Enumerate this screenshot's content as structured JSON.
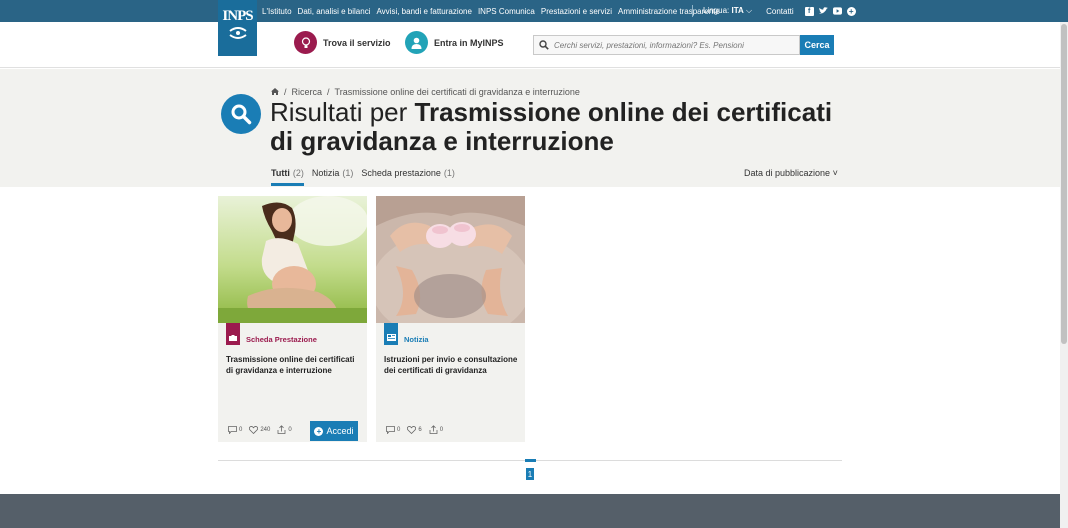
{
  "topbar": {
    "logo_text": "INPS",
    "links": [
      "L'Istituto",
      "Dati, analisi e bilanci",
      "Avvisi, bandi e fatturazione",
      "INPS Comunica",
      "Prestazioni e servizi",
      "Amministrazione trasparente"
    ],
    "lingua_label": "Lingua:",
    "lingua_value": "ITA",
    "contatti": "Contatti",
    "social_icons": [
      "facebook-icon",
      "twitter-icon",
      "youtube-icon",
      "plus-icon"
    ]
  },
  "header": {
    "trova": "Trova il servizio",
    "myinps": "Entra in MyINPS",
    "search_placeholder": "Cerchi servizi, prestazioni, informazioni? Es. Pensioni",
    "search_button": "Cerca",
    "colors": {
      "trova": "#9b1b4e",
      "myinps": "#22a3b7",
      "accent": "#1a7db5"
    }
  },
  "results": {
    "breadcrumb": [
      "Ricerca",
      "Trasmissione online dei certificati di gravidanza e interruzione"
    ],
    "title_prefix": "Risultati per ",
    "title_query": "Trasmissione online dei certificati di gravidanza e interruzione",
    "tabs": [
      {
        "label": "Tutti",
        "count": "(2)"
      },
      {
        "label": "Notizia",
        "count": "(1)"
      },
      {
        "label": "Scheda prestazione",
        "count": "(1)"
      }
    ],
    "sort_label": "Data di pubblicazione"
  },
  "cards": [
    {
      "type": "Scheda Prestazione",
      "type_color": "#9b1b4e",
      "title": "Trasmissione online dei certificati di gravidanza e interruzione",
      "comments": "0",
      "likes": "240",
      "shares": "0",
      "button": "Accedi"
    },
    {
      "type": "Notizia",
      "type_color": "#1a7db5",
      "title": "Istruzioni per invio e consultazione dei certificati di gravidanza",
      "comments": "0",
      "likes": "6",
      "shares": "0"
    }
  ],
  "pagination": {
    "current": "1"
  }
}
